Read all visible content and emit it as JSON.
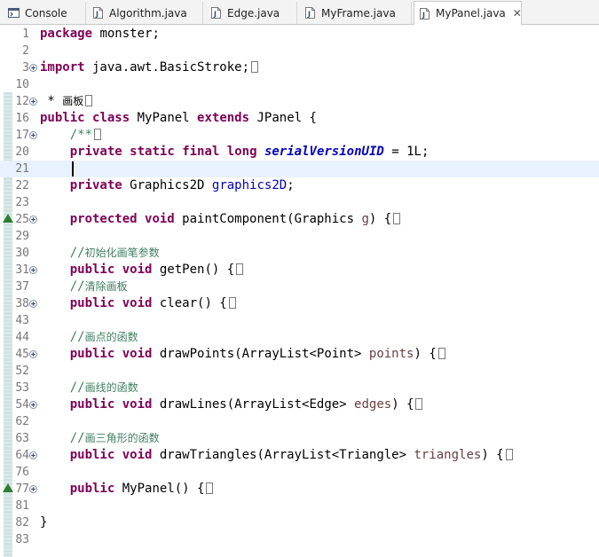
{
  "tabs": [
    {
      "label": "Console",
      "icon": "console-icon",
      "closable": false
    },
    {
      "label": "Algorithm.java",
      "icon": "java-file-icon",
      "closable": false
    },
    {
      "label": "Edge.java",
      "icon": "java-file-icon",
      "closable": false
    },
    {
      "label": "MyFrame.java",
      "icon": "java-file-icon",
      "closable": false
    },
    {
      "label": "MyPanel.java",
      "icon": "java-file-icon",
      "closable": true,
      "close_label": "✕",
      "active": true
    }
  ],
  "editor": {
    "lines": [
      {
        "num": "1",
        "fold": null,
        "tokens": [
          {
            "t": "package",
            "c": "kw"
          },
          {
            "t": " monster;"
          }
        ]
      },
      {
        "num": "2",
        "fold": null,
        "tokens": []
      },
      {
        "num": "3",
        "fold": "collapsed",
        "tokens": [
          {
            "t": "import",
            "c": "kw"
          },
          {
            "t": " java.awt.BasicStroke;"
          }
        ],
        "folded": true
      },
      {
        "num": "10",
        "fold": null,
        "tokens": []
      },
      {
        "num": "12",
        "fold": "collapsed",
        "tokens": [
          {
            "t": " * "
          },
          {
            "t": "画板",
            "c": "cjk"
          }
        ],
        "folded": true
      },
      {
        "num": "16",
        "fold": null,
        "tokens": [
          {
            "t": "public",
            "c": "kw"
          },
          {
            "t": " "
          },
          {
            "t": "class",
            "c": "kw"
          },
          {
            "t": " MyPanel "
          },
          {
            "t": "extends",
            "c": "kw"
          },
          {
            "t": " JPanel {"
          }
        ]
      },
      {
        "num": "17",
        "fold": "collapsed",
        "tokens": [
          {
            "t": "    "
          },
          {
            "t": "/**",
            "c": "cmt"
          }
        ],
        "folded": true
      },
      {
        "num": "20",
        "fold": null,
        "tokens": [
          {
            "t": "    "
          },
          {
            "t": "private",
            "c": "kw"
          },
          {
            "t": " "
          },
          {
            "t": "static",
            "c": "kw"
          },
          {
            "t": " "
          },
          {
            "t": "final",
            "c": "kw"
          },
          {
            "t": " "
          },
          {
            "t": "long",
            "c": "kw"
          },
          {
            "t": " "
          },
          {
            "t": "serialVersionUID",
            "c": "sfield"
          },
          {
            "t": " = 1L;"
          }
        ]
      },
      {
        "num": "21",
        "fold": null,
        "tokens": [],
        "current": true
      },
      {
        "num": "22",
        "fold": null,
        "tokens": [
          {
            "t": "    "
          },
          {
            "t": "private",
            "c": "kw"
          },
          {
            "t": " Graphics2D "
          },
          {
            "t": "graphics2D",
            "c": "field"
          },
          {
            "t": ";"
          }
        ]
      },
      {
        "num": "23",
        "fold": null,
        "tokens": []
      },
      {
        "num": "25",
        "fold": "collapsed",
        "override": true,
        "tokens": [
          {
            "t": "    "
          },
          {
            "t": "protected",
            "c": "kw"
          },
          {
            "t": " "
          },
          {
            "t": "void",
            "c": "kw"
          },
          {
            "t": " paintComponent(Graphics "
          },
          {
            "t": "g",
            "c": "param"
          },
          {
            "t": ") {"
          }
        ],
        "folded": true
      },
      {
        "num": "29",
        "fold": null,
        "tokens": []
      },
      {
        "num": "30",
        "fold": null,
        "tokens": [
          {
            "t": "    "
          },
          {
            "t": "//",
            "c": "cmt"
          },
          {
            "t": "初始化画笔参数",
            "c": "cmt cjk"
          }
        ]
      },
      {
        "num": "31",
        "fold": "collapsed",
        "tokens": [
          {
            "t": "    "
          },
          {
            "t": "public",
            "c": "kw"
          },
          {
            "t": " "
          },
          {
            "t": "void",
            "c": "kw"
          },
          {
            "t": " getPen() {"
          }
        ],
        "folded": true
      },
      {
        "num": "37",
        "fold": null,
        "tokens": [
          {
            "t": "    "
          },
          {
            "t": "//",
            "c": "cmt"
          },
          {
            "t": "清除画板",
            "c": "cmt cjk"
          }
        ]
      },
      {
        "num": "38",
        "fold": "collapsed",
        "tokens": [
          {
            "t": "    "
          },
          {
            "t": "public",
            "c": "kw"
          },
          {
            "t": " "
          },
          {
            "t": "void",
            "c": "kw"
          },
          {
            "t": " clear() {"
          }
        ],
        "folded": true
      },
      {
        "num": "43",
        "fold": null,
        "tokens": []
      },
      {
        "num": "44",
        "fold": null,
        "tokens": [
          {
            "t": "    "
          },
          {
            "t": "//",
            "c": "cmt"
          },
          {
            "t": "画点的函数",
            "c": "cmt cjk"
          }
        ]
      },
      {
        "num": "45",
        "fold": "collapsed",
        "tokens": [
          {
            "t": "    "
          },
          {
            "t": "public",
            "c": "kw"
          },
          {
            "t": " "
          },
          {
            "t": "void",
            "c": "kw"
          },
          {
            "t": " drawPoints(ArrayList<Point> "
          },
          {
            "t": "points",
            "c": "param"
          },
          {
            "t": ") {"
          }
        ],
        "folded": true
      },
      {
        "num": "52",
        "fold": null,
        "tokens": []
      },
      {
        "num": "53",
        "fold": null,
        "tokens": [
          {
            "t": "    "
          },
          {
            "t": "//",
            "c": "cmt"
          },
          {
            "t": "画线的函数",
            "c": "cmt cjk"
          }
        ]
      },
      {
        "num": "54",
        "fold": "collapsed",
        "tokens": [
          {
            "t": "    "
          },
          {
            "t": "public",
            "c": "kw"
          },
          {
            "t": " "
          },
          {
            "t": "void",
            "c": "kw"
          },
          {
            "t": " drawLines(ArrayList<Edge> "
          },
          {
            "t": "edges",
            "c": "param"
          },
          {
            "t": ") {"
          }
        ],
        "folded": true
      },
      {
        "num": "62",
        "fold": null,
        "tokens": []
      },
      {
        "num": "63",
        "fold": null,
        "tokens": [
          {
            "t": "    "
          },
          {
            "t": "//",
            "c": "cmt"
          },
          {
            "t": "画三角形的函数",
            "c": "cmt cjk"
          }
        ]
      },
      {
        "num": "64",
        "fold": "collapsed",
        "tokens": [
          {
            "t": "    "
          },
          {
            "t": "public",
            "c": "kw"
          },
          {
            "t": " "
          },
          {
            "t": "void",
            "c": "kw"
          },
          {
            "t": " drawTriangles(ArrayList<Triangle> "
          },
          {
            "t": "triangles",
            "c": "param"
          },
          {
            "t": ") {"
          }
        ],
        "folded": true
      },
      {
        "num": "76",
        "fold": null,
        "tokens": []
      },
      {
        "num": "77",
        "fold": "collapsed",
        "override": true,
        "tokens": [
          {
            "t": "    "
          },
          {
            "t": "public",
            "c": "kw"
          },
          {
            "t": " MyPanel() {"
          }
        ],
        "folded": true
      },
      {
        "num": "81",
        "fold": null,
        "tokens": []
      },
      {
        "num": "82",
        "fold": null,
        "tokens": [
          {
            "t": "}"
          }
        ]
      },
      {
        "num": "83",
        "fold": null,
        "tokens": []
      }
    ]
  }
}
